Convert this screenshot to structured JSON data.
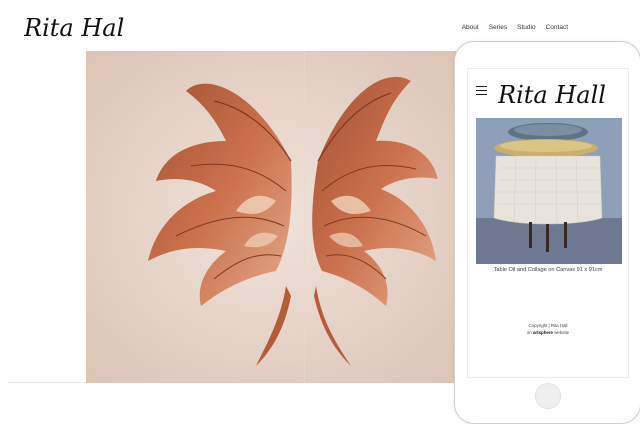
{
  "site": {
    "logo": "Rita Hall.",
    "nav": [
      "About",
      "Series",
      "Studio",
      "Contact"
    ]
  },
  "hero": {
    "alt": "Wings artwork"
  },
  "mobile": {
    "logo": "Rita Hall.",
    "caption": "Table Oil and Collage on Canvas 91 x 91cm",
    "copyright": "Copyright | Rita Hall",
    "credit_prefix": "on",
    "credit_brand": "artsphere",
    "credit_suffix": "website"
  },
  "colors": {
    "hero_bg": "#eadbd2",
    "feather": "#c0623d",
    "feather_light": "#e6b393"
  }
}
